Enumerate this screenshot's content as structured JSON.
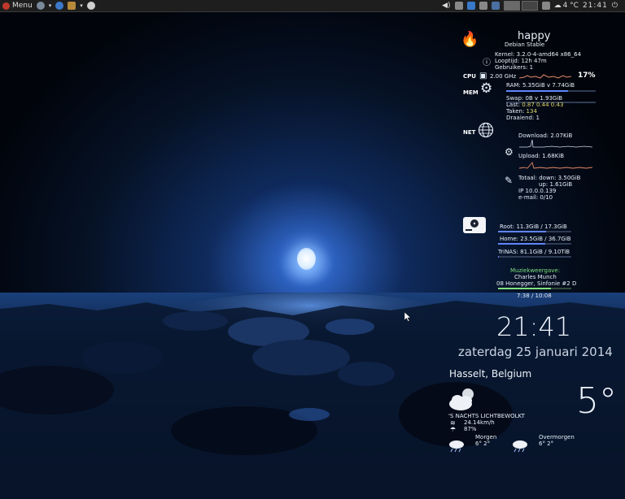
{
  "panel": {
    "menu_label": "Menu",
    "temperature": "4 °C",
    "clock": "21:41"
  },
  "conky": {
    "hostname": "happy",
    "distro": "Debian Stable",
    "kernel": "Kernel: 3.2.0-4-amd64 x86_64",
    "uptime": "Looptijd: 12h 47m",
    "users": "Gebruikers: 1",
    "cpu_label": "CPU",
    "cpu_freq": "2.00 GHz",
    "cpu_percent": "17%",
    "mem_label": "MEM",
    "ram": "RAM: 5.35GiB v 7.74GiB",
    "ram_fraction": 0.69,
    "swap": "Swap: 0B   v 1.93GiB",
    "swap_fraction": 0.0,
    "load_label": "Last:",
    "load_values": "0.87 0.44 0.43",
    "tasks_label": "Taken:",
    "tasks_value": "134",
    "running": "Draaiend: 1",
    "net_label": "NET",
    "download": "Download: 2.07KiB",
    "upload": "Upload: 1.68KiB",
    "total_down": "Totaal: down: 3.50GiB",
    "total_up": "up: 1.61GiB",
    "ip": "IP        10.0.0.139",
    "email": "e-mail: 0/10",
    "disks": [
      {
        "label": "Root: 11.3GiB / 17.3GiB",
        "fraction": 0.65
      },
      {
        "label": "Home: 23.5GiB / 36.7GiB",
        "fraction": 0.64
      },
      {
        "label": "TriNAS: 81.1GiB / 9.10TiB",
        "fraction": 0.01
      }
    ],
    "music_heading": "Muziekweergave:",
    "music_artist": "Charles Munch",
    "music_track": "08 Honegger, Sinfonie #2 D",
    "music_progress": 0.72,
    "music_time": "7:38 / 10:08"
  },
  "clock": {
    "time": "21:41",
    "date": "zaterdag 25 januari 2014"
  },
  "weather": {
    "location": "Hasselt, Belgium",
    "temperature": "5°",
    "condition": "'S NACHTS LICHTBEWOLKT",
    "wind": "24.14km/h",
    "humidity": "87%",
    "tomorrow_label": "Morgen",
    "tomorrow_temps": "6°  2°",
    "dayafter_label": "Overmorgen",
    "dayafter_temps": "6°  2°"
  },
  "colors": {
    "bar_fill": "#5f86ff",
    "music_bar": "#7ee17e",
    "graph_line": "#e58a6a"
  }
}
